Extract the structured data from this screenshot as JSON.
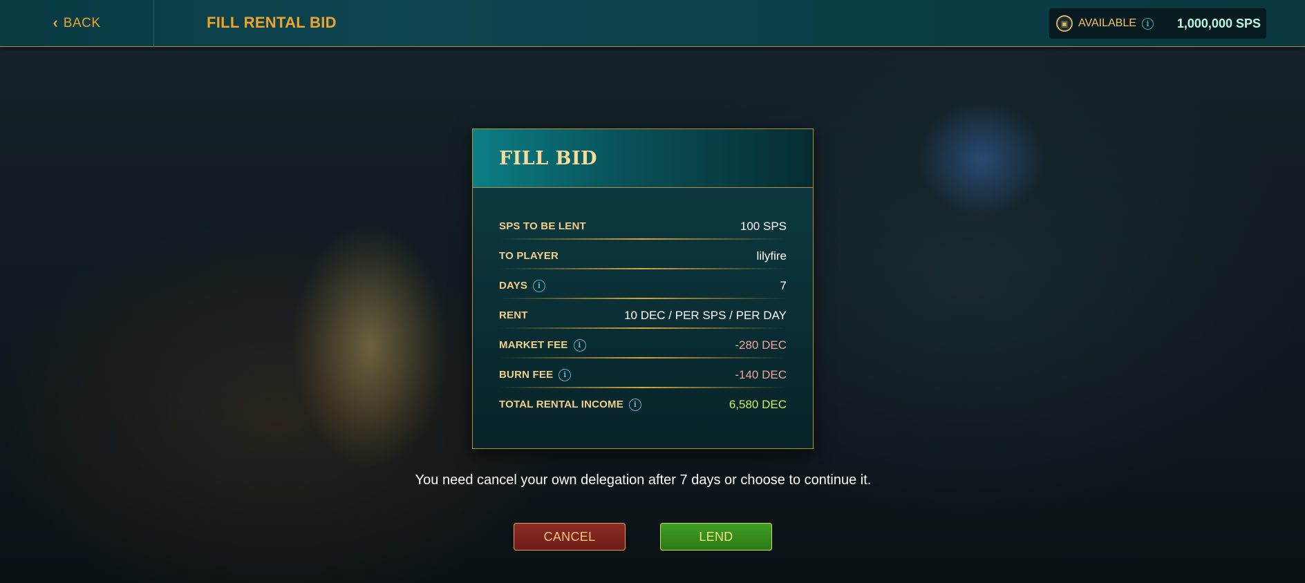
{
  "topbar": {
    "back_label": "BACK",
    "page_title": "FILL RENTAL BID",
    "available_label": "AVAILABLE",
    "available_value": "1,000,000 SPS"
  },
  "modal": {
    "title": "FILL BID",
    "rows": [
      {
        "label": "SPS TO BE LENT",
        "value": "100 SPS",
        "info": false
      },
      {
        "label": "TO PLAYER",
        "value": "lilyfire",
        "info": false
      },
      {
        "label": "DAYS",
        "value": "7",
        "info": true
      },
      {
        "label": "RENT",
        "value": "10 DEC / PER SPS / PER DAY",
        "info": false
      },
      {
        "label": "MARKET FEE",
        "value": "-280 DEC",
        "info": true
      },
      {
        "label": "BURN FEE",
        "value": "-140 DEC",
        "info": true
      },
      {
        "label": "TOTAL RENTAL INCOME",
        "value": "6,580 DEC",
        "info": true
      }
    ]
  },
  "note": "You need cancel your own delegation after 7 days or choose to continue it.",
  "buttons": {
    "cancel": "CANCEL",
    "lend": "LEND"
  },
  "colors": {
    "accent_gold": "#f0a52a",
    "negative": "#f3a29a",
    "positive": "#c9f060",
    "header_teal": "#0a3a44"
  },
  "icons": {
    "back": "chevron-left-icon",
    "currency": "sps-token-icon",
    "info": "info-icon"
  }
}
